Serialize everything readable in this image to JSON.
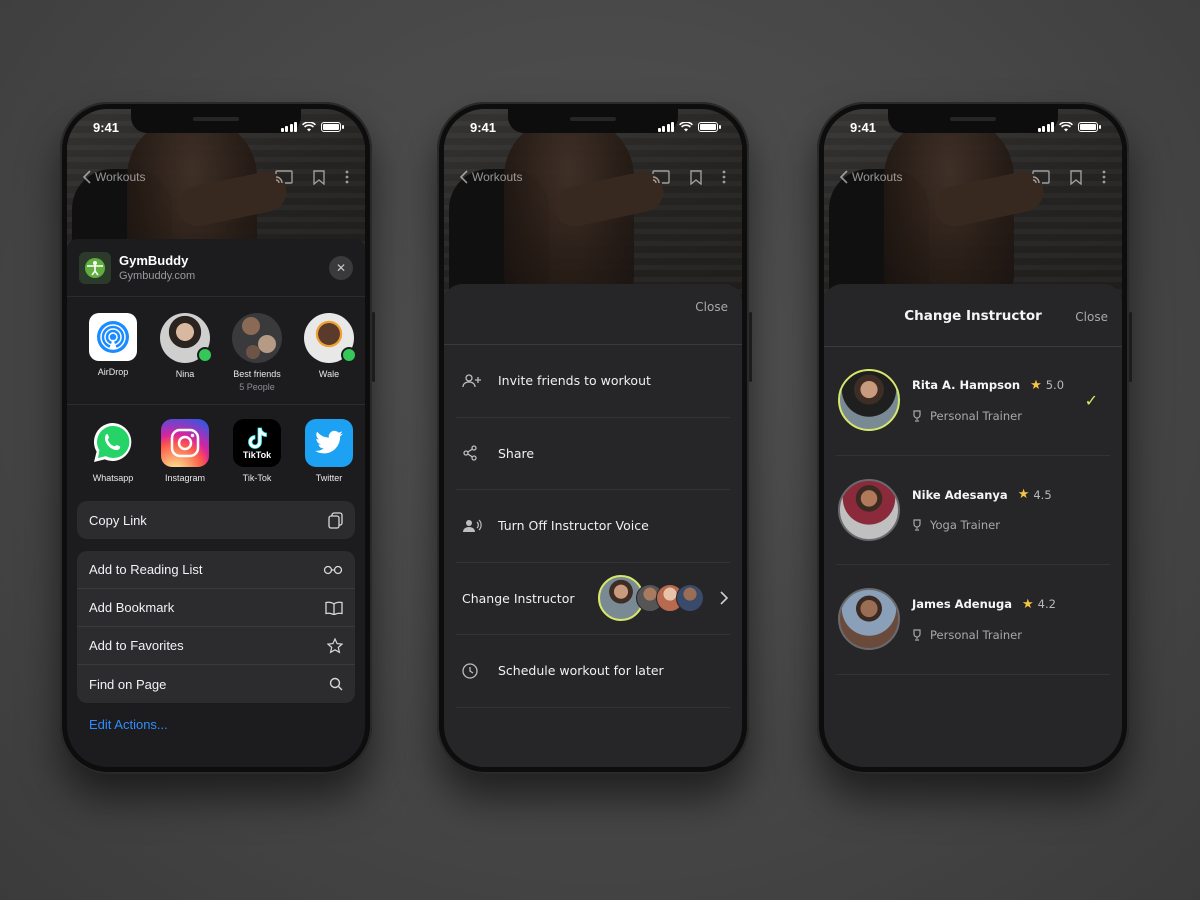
{
  "status": {
    "time": "9:41"
  },
  "nav": {
    "back_label": "Workouts"
  },
  "phone1": {
    "share_header": {
      "app_name": "GymBuddy",
      "app_url": "Gymbuddy.com"
    },
    "contacts": [
      {
        "name": "AirDrop",
        "sub": ""
      },
      {
        "name": "Nina",
        "sub": ""
      },
      {
        "name": "Best friends",
        "sub": "5 People"
      },
      {
        "name": "Wale",
        "sub": ""
      }
    ],
    "apps": [
      {
        "name": "Whatsapp"
      },
      {
        "name": "Instagram"
      },
      {
        "name": "Tik-Tok",
        "logo_text": "TikTok"
      },
      {
        "name": "Twitter"
      }
    ],
    "copy_link": "Copy Link",
    "actions": [
      {
        "label": "Add to Reading List",
        "icon": "glasses-icon"
      },
      {
        "label": "Add Bookmark",
        "icon": "book-icon"
      },
      {
        "label": "Add to Favorites",
        "icon": "star-icon"
      },
      {
        "label": "Find on Page",
        "icon": "search-icon"
      }
    ],
    "edit_actions": "Edit Actions..."
  },
  "phone2": {
    "close": "Close",
    "menu": [
      {
        "label": "Invite friends to workout",
        "icon": "add-user-icon"
      },
      {
        "label": "Share",
        "icon": "share-icon"
      },
      {
        "label": "Turn Off Instructor Voice",
        "icon": "voice-icon"
      },
      {
        "label": "Change Instructor",
        "icon": ""
      },
      {
        "label": "Schedule workout for later",
        "icon": "clock-icon"
      }
    ]
  },
  "phone3": {
    "title": "Change Instructor",
    "close": "Close",
    "instructors": [
      {
        "name": "Rita A. Hampson",
        "rating": "5.0",
        "role": "Personal Trainer",
        "selected": true
      },
      {
        "name": "Nike Adesanya",
        "rating": "4.5",
        "role": "Yoga Trainer",
        "selected": false
      },
      {
        "name": "James  Adenuga",
        "rating": "4.2",
        "role": "Personal Trainer",
        "selected": false
      }
    ]
  },
  "colors": {
    "accent_lime": "#d6e86b",
    "link_blue": "#2f8cff",
    "sheet_bg": "#262628",
    "star": "#f5c542"
  }
}
